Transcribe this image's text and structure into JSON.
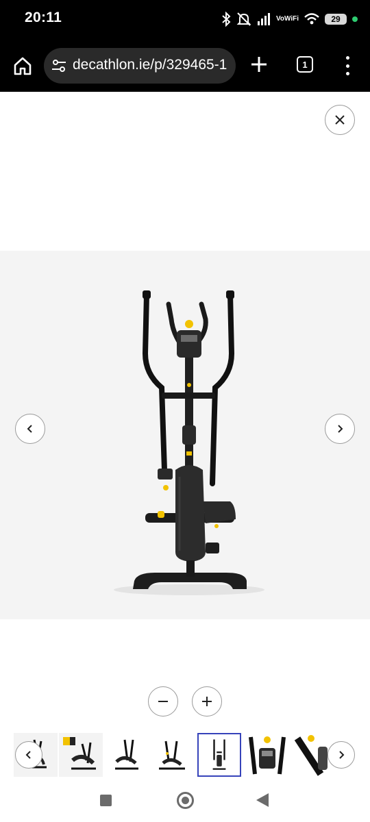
{
  "status_bar": {
    "time": "20:11",
    "vowifi_top": "Vo",
    "vowifi_bottom": "WiFi",
    "battery": "29",
    "icons": [
      "bluetooth-icon",
      "mute-icon",
      "signal-icon",
      "vowifi-icon",
      "wifi-icon",
      "battery-icon",
      "privacy-dot-icon"
    ],
    "dot_color": "#2ecc71"
  },
  "browser": {
    "url": "decathlon.ie/p/329465-1",
    "tab_count": "1",
    "icons": [
      "home-icon",
      "site-settings-icon",
      "new-tab-plus-icon",
      "tab-switcher-icon",
      "more-menu-icon"
    ]
  },
  "viewer": {
    "icons": [
      "close-icon",
      "chevron-left-icon",
      "chevron-right-icon",
      "zoom-out-icon",
      "zoom-in-icon"
    ],
    "product_image": "elliptical-cross-trainer",
    "selected_thumbnail_index": 4,
    "thumbnails": [
      {
        "name": "thumb-side-view"
      },
      {
        "name": "thumb-with-badge"
      },
      {
        "name": "thumb-angle-view"
      },
      {
        "name": "thumb-rear-angle"
      },
      {
        "name": "thumb-front-view"
      },
      {
        "name": "thumb-console-detail"
      },
      {
        "name": "thumb-handle-detail"
      }
    ],
    "accent_color": "#3643ba",
    "highlight_color": "#f2c200"
  },
  "android_nav": {
    "icons": [
      "recents-square-icon",
      "home-circle-icon",
      "back-triangle-icon"
    ]
  }
}
